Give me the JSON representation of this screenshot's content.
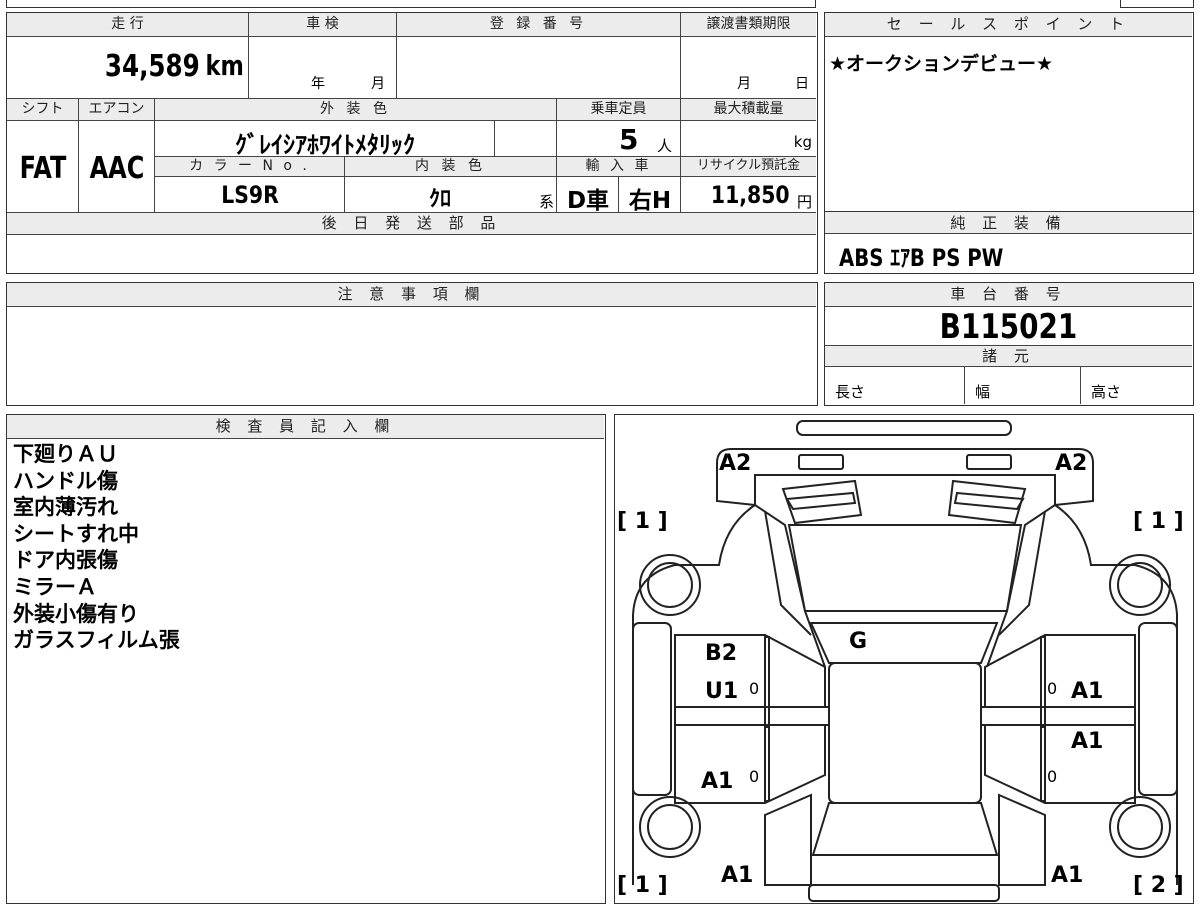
{
  "header": {
    "mileage_label": "走 行",
    "inspection_label": "車 検",
    "registration_label": "登 録 番 号",
    "transfer_deadline_label": "譲渡書類期限",
    "mileage_value": "34,589",
    "mileage_unit": "km",
    "year_unit": "年",
    "month_unit": "月",
    "day_unit": "日",
    "transfer_month_unit": "月"
  },
  "specs": {
    "shift_label": "シフト",
    "ac_label": "エアコン",
    "exterior_label": "外 装 色",
    "capacity_label": "乗車定員",
    "max_load_label": "最大積載量",
    "shift_value": "FAT",
    "ac_value": "AAC",
    "exterior_value": "ｸﾞﾚｲｼｱﾎﾜｲﾄﾒﾀﾘｯｸ",
    "capacity_value": "5",
    "capacity_unit": "人",
    "max_load_unit": "kg",
    "color_no_label": "カ ラ ー N o .",
    "interior_label": "内 装 色",
    "import_label": "輸 入 車",
    "recycle_label": "リサイクル預託金",
    "color_no_value": "LS9R",
    "interior_value": "ｸﾛ",
    "interior_suffix": "系",
    "import_value": "D車",
    "handle_value": "右H",
    "recycle_value": "11,850",
    "recycle_unit": "円"
  },
  "later_parts": {
    "label": "後 日 発 送 部 品"
  },
  "sales_point": {
    "label": "セ ー ル ス ポ イ ン ト",
    "text": "★オークションデビュー★"
  },
  "equipment": {
    "label": "純 正 装 備",
    "text": "ABS ｴｱB PS PW"
  },
  "notes": {
    "label": "注 意 事 項 欄"
  },
  "chassis": {
    "label": "車 台 番 号",
    "value": "B115021"
  },
  "dimensions": {
    "label": "諸 元",
    "length_label": "長さ",
    "width_label": "幅",
    "height_label": "高さ"
  },
  "inspector": {
    "label": "検 査 員 記 入 欄",
    "lines": [
      "下廻りＡＵ",
      "ハンドル傷",
      "室内薄汚れ",
      "シートすれ中",
      "ドア内張傷",
      "ミラーＡ",
      "外装小傷有り",
      "ガラスフィルム張"
    ]
  },
  "diagram": {
    "marks": {
      "front_left": "A2",
      "front_right": "A2",
      "windshield": "G",
      "left_front_door_1": "B2",
      "left_front_door_2": "U1",
      "left_rear_door": "A1",
      "left_rear": "A1",
      "right_front_door": "A1",
      "right_rear_door": "A1",
      "right_rear": "A1",
      "zero_1": "0",
      "zero_2": "0",
      "zero_3": "0",
      "zero_4": "0"
    },
    "brackets": {
      "top_left": "[ 1 ]",
      "top_right": "[ 1 ]",
      "bottom_left": "[ 1 ]",
      "bottom_right": "[ 2 ]"
    }
  }
}
